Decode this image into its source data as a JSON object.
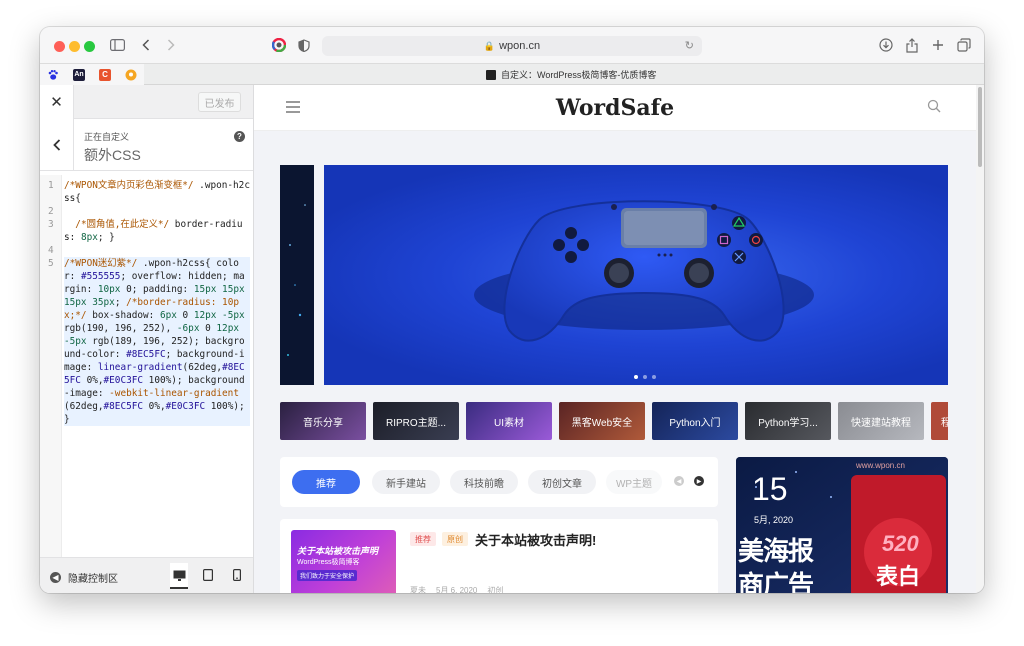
{
  "browser": {
    "url": "wpon.cn",
    "tab_title": "自定义：WordPress极简博客-优质博客",
    "traffic_colors": {
      "close": "#fe5f57",
      "min": "#febc2e",
      "max": "#28c840"
    }
  },
  "customizer": {
    "publish_label": "已发布",
    "subtitle": "正在自定义",
    "section_title": "额外CSS",
    "help": "?",
    "code_lines": [
      {
        "n": "1",
        "text": "/*WPON文章内页彩色渐变框*/ .wpon-h2css{"
      },
      {
        "n": "2",
        "text": ""
      },
      {
        "n": "3",
        "text": "  /*圆角值,在此定义*/ border-radius: 8px; }"
      },
      {
        "n": "4",
        "text": ""
      },
      {
        "n": "5",
        "text": "/*WPON迷幻紫*/ .wpon-h2css{ color: #555555; overflow: hidden; margin: 10px 0; padding: 15px 15px 15px 35px; /*border-radius: 10px;*/ box-shadow: 6px 0 12px -5px rgb(190, 196, 252), -6px 0 12px -5px rgb(189, 196, 252); background-color: #8EC5FC; background-image: linear-gradient(62deg,#8EC5FC 0%,#E0C3FC 100%); background-image: -webkit-linear-gradient(62deg,#8EC5FC 0%,#E0C3FC 100%); }"
      }
    ],
    "hide_controls": "隐藏控制区"
  },
  "site": {
    "logo": "WordSafe",
    "categories": [
      {
        "label": "音乐分享",
        "color": "#5b3e8a"
      },
      {
        "label": "RIPRO主题...",
        "color": "#2d2f3f"
      },
      {
        "label": "UI素材",
        "color": "#6a3ac0"
      },
      {
        "label": "黑客Web安全",
        "color": "#7a3030"
      },
      {
        "label": "Python入门",
        "color": "#1e3070"
      },
      {
        "label": "Python学习...",
        "color": "#3a3c40"
      },
      {
        "label": "快速建站教程",
        "color": "#9a9ca2"
      },
      {
        "label": "程",
        "color": "#b04a38"
      }
    ],
    "tabs": [
      "推荐",
      "新手建站",
      "科技前瞻",
      "初创文章",
      "WP主题"
    ],
    "post": {
      "thumb_title": "关于本站被攻击声明",
      "thumb_sub": "WordPress极简博客",
      "thumb_tag": "我们致力于安全保护",
      "badge1": "推荐",
      "badge2": "原创",
      "title": "关于本站被攻击声明!",
      "meta": [
        "夏未",
        "5月 6, 2020",
        "初创"
      ]
    },
    "date_card": {
      "day": "15",
      "month": "5月, 2020",
      "watermark": "www.wpon.cn",
      "big1": "美海报",
      "big2": "商广告",
      "tag": "520",
      "tag2": "表白"
    }
  }
}
